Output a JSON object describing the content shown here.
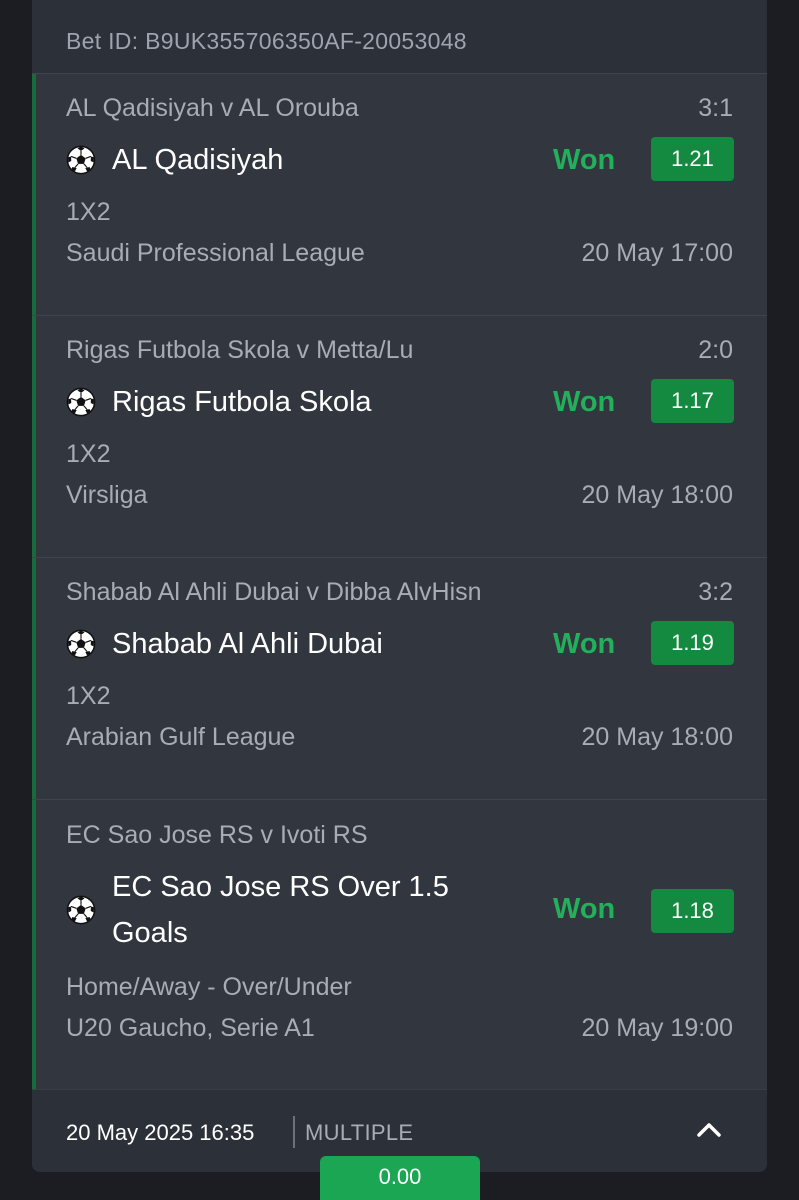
{
  "bet_id": "Bet ID: B9UK355706350AF-20053048",
  "selections": [
    {
      "match": "AL Qadisiyah v AL Orouba",
      "score": "3:1",
      "pick": "AL Qadisiyah",
      "status": "Won",
      "odds": "1.21",
      "market": "1X2",
      "league": "Saudi Professional League",
      "time": "20 May 17:00"
    },
    {
      "match": "Rigas Futbola Skola v Metta/Lu",
      "score": "2:0",
      "pick": "Rigas Futbola Skola",
      "status": "Won",
      "odds": "1.17",
      "market": "1X2",
      "league": "Virsliga",
      "time": "20 May 18:00"
    },
    {
      "match": "Shabab Al Ahli Dubai v Dibba AlvHisn",
      "score": "3:2",
      "pick": "Shabab Al Ahli Dubai",
      "status": "Won",
      "odds": "1.19",
      "market": "1X2",
      "league": "Arabian Gulf League",
      "time": "20 May 18:00"
    },
    {
      "match": "EC Sao Jose RS v Ivoti RS",
      "score": "",
      "pick_line1": "EC Sao Jose RS Over 1.5",
      "pick_line2": "Goals",
      "status": "Won",
      "odds": "1.18",
      "market": "Home/Away - Over/Under",
      "league": "U20 Gaucho, Serie A1",
      "time": "20 May 19:00"
    }
  ],
  "footer": {
    "placed": "20 May 2025 16:35",
    "bet_type": "MULTIPLE",
    "payout": "0.00",
    "toggle_icon": "chevron-up-icon"
  },
  "colors": {
    "won": "#23b05a",
    "odds_badge": "#138a3f",
    "payout_button": "#1aa652"
  },
  "icons": {
    "sport": "soccer-ball-icon"
  }
}
